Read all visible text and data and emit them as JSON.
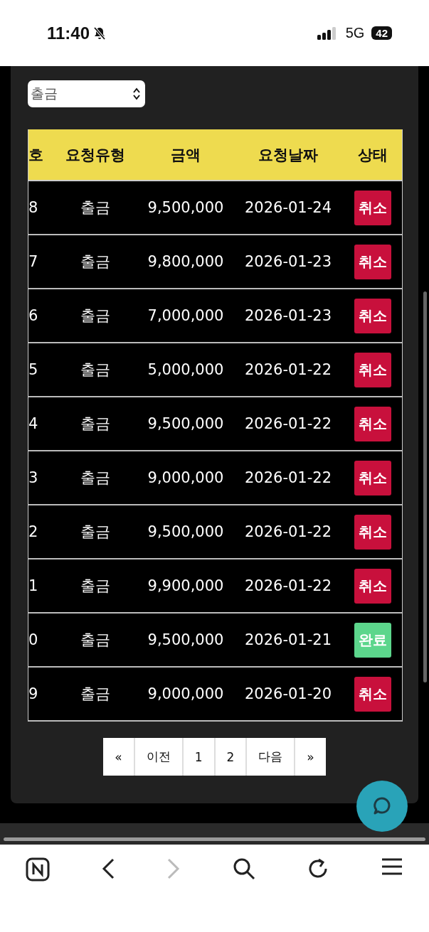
{
  "status_bar": {
    "time": "11:40",
    "network": "5G",
    "battery": "42"
  },
  "filter": {
    "value": "출금"
  },
  "table": {
    "columns": [
      "호",
      "요청유형",
      "금액",
      "요청날짜",
      "상태"
    ],
    "rows": [
      {
        "number": "8",
        "type": "출금",
        "amount": "9,500,000",
        "date": "2026-01-24",
        "status": {
          "label": "취소",
          "kind": "cancelled"
        }
      },
      {
        "number": "7",
        "type": "출금",
        "amount": "9,800,000",
        "date": "2026-01-23",
        "status": {
          "label": "취소",
          "kind": "cancelled"
        }
      },
      {
        "number": "6",
        "type": "출금",
        "amount": "7,000,000",
        "date": "2026-01-23",
        "status": {
          "label": "취소",
          "kind": "cancelled"
        }
      },
      {
        "number": "5",
        "type": "출금",
        "amount": "5,000,000",
        "date": "2026-01-22",
        "status": {
          "label": "취소",
          "kind": "cancelled"
        }
      },
      {
        "number": "4",
        "type": "출금",
        "amount": "9,500,000",
        "date": "2026-01-22",
        "status": {
          "label": "취소",
          "kind": "cancelled"
        }
      },
      {
        "number": "3",
        "type": "출금",
        "amount": "9,000,000",
        "date": "2026-01-22",
        "status": {
          "label": "취소",
          "kind": "cancelled"
        }
      },
      {
        "number": "2",
        "type": "출금",
        "amount": "9,500,000",
        "date": "2026-01-22",
        "status": {
          "label": "취소",
          "kind": "cancelled"
        }
      },
      {
        "number": "1",
        "type": "출금",
        "amount": "9,900,000",
        "date": "2026-01-22",
        "status": {
          "label": "취소",
          "kind": "cancelled"
        }
      },
      {
        "number": "0",
        "type": "출금",
        "amount": "9,500,000",
        "date": "2026-01-21",
        "status": {
          "label": "완료",
          "kind": "completed"
        }
      },
      {
        "number": "9",
        "type": "출금",
        "amount": "9,000,000",
        "date": "2026-01-20",
        "status": {
          "label": "취소",
          "kind": "cancelled"
        }
      }
    ]
  },
  "pagination": [
    "«",
    "이전",
    "1",
    "2",
    "다음",
    "»"
  ]
}
